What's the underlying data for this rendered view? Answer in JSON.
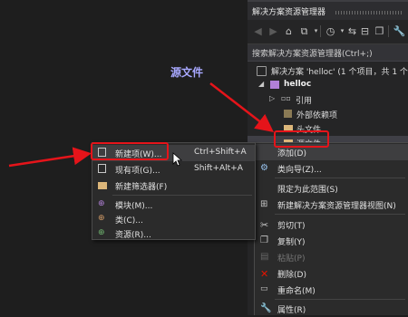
{
  "panel": {
    "title": "解决方案资源管理器",
    "search_placeholder": "搜索解决方案资源管理器(Ctrl+;)"
  },
  "tree": {
    "solution": "解决方案 'helloc' (1 个项目，共 1 个",
    "project": "helloc",
    "references": "引用",
    "external_deps": "外部依赖项",
    "header_files": "头文件",
    "source_files": "源文件"
  },
  "annotation": {
    "label": "源文件"
  },
  "menu_add": {
    "items": [
      {
        "label": "新建项(W)...",
        "shortcut": "Ctrl+Shift+A"
      },
      {
        "label": "现有项(G)...",
        "shortcut": "Shift+Alt+A"
      },
      {
        "label": "新建筛选器(F)",
        "shortcut": ""
      },
      {
        "label": "模块(M)...",
        "shortcut": ""
      },
      {
        "label": "类(C)...",
        "shortcut": ""
      },
      {
        "label": "资源(R)...",
        "shortcut": ""
      }
    ]
  },
  "menu_context": {
    "items": [
      {
        "label": "添加(D)"
      },
      {
        "label": "类向导(Z)..."
      },
      {
        "label": "限定为此范围(S)"
      },
      {
        "label": "新建解决方案资源管理器视图(N)"
      },
      {
        "label": "剪切(T)"
      },
      {
        "label": "复制(Y)"
      },
      {
        "label": "粘贴(P)"
      },
      {
        "label": "删除(D)"
      },
      {
        "label": "重命名(M)"
      },
      {
        "label": "属性(R)"
      }
    ]
  },
  "colors": {
    "annotation_red": "#e5141a",
    "folder": "#dcb67a",
    "accent": "#3e3e42"
  }
}
